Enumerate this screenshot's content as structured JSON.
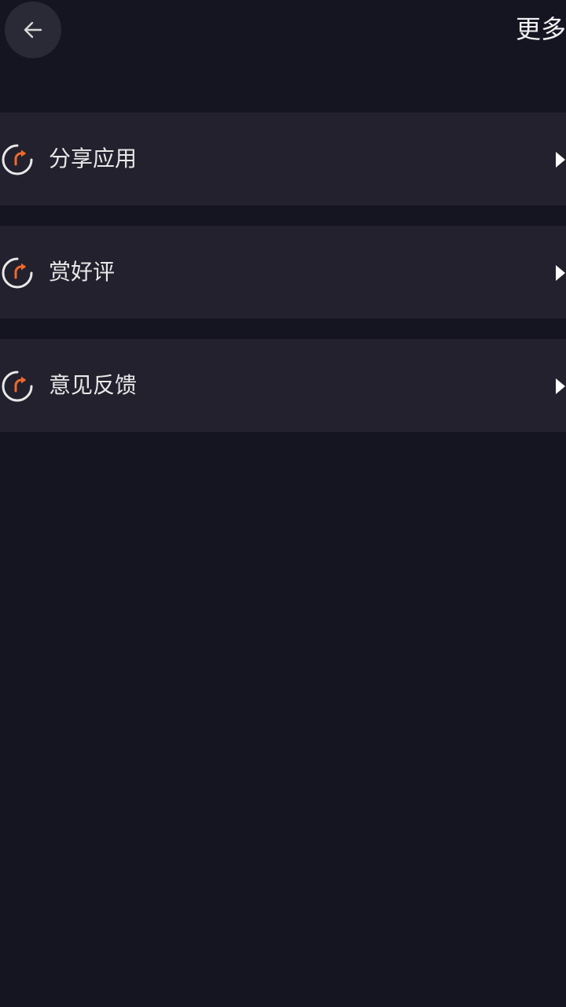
{
  "header": {
    "title": "更多",
    "back_icon": "arrow-left-icon"
  },
  "menu": {
    "items": [
      {
        "label": "分享应用",
        "icon": "refresh-arrow-icon"
      },
      {
        "label": "赏好评",
        "icon": "refresh-arrow-icon"
      },
      {
        "label": "意见反馈",
        "icon": "refresh-arrow-icon"
      }
    ],
    "arrow_icon": "triangle-right-icon"
  },
  "colors": {
    "background": "#151421",
    "item_background": "#22212d",
    "accent": "#f06a2c",
    "text": "#e8e8e8"
  }
}
